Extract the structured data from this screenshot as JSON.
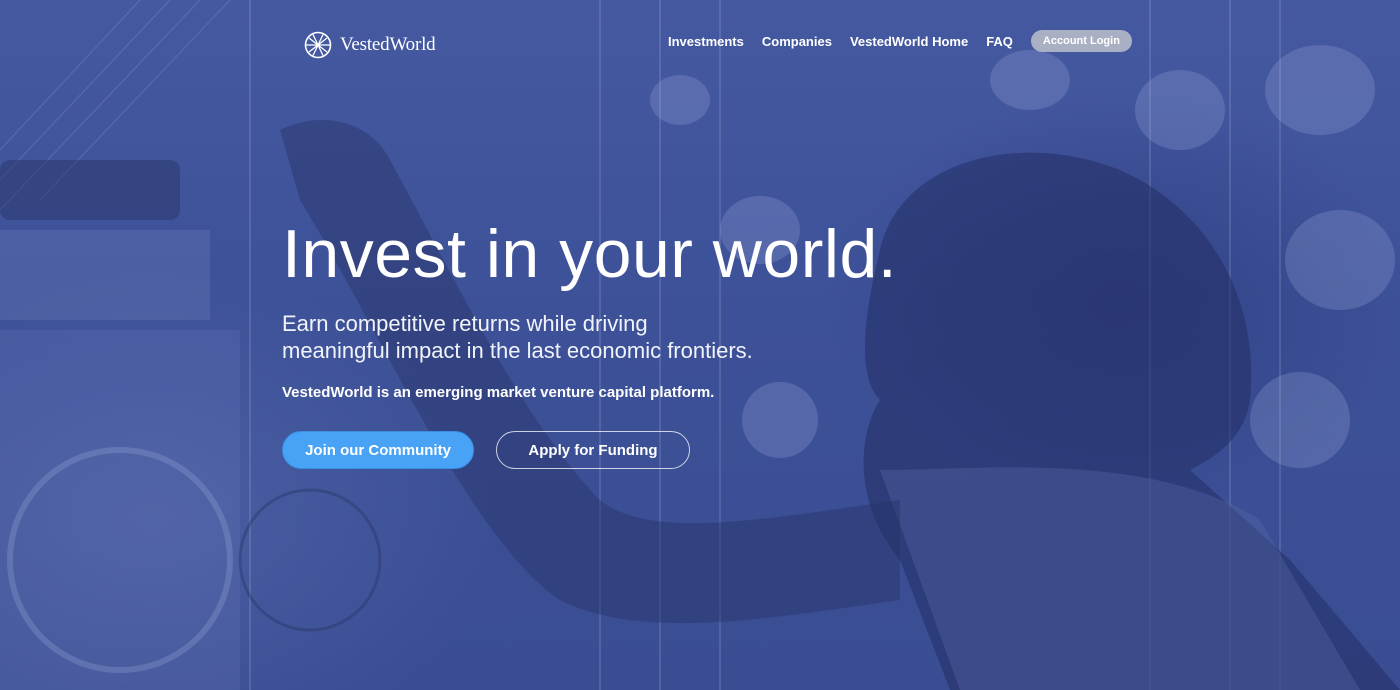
{
  "brand": {
    "name": "VestedWorld",
    "logo_icon": "globe-lattice-icon"
  },
  "nav": {
    "items": [
      {
        "label": "Investments"
      },
      {
        "label": "Companies"
      },
      {
        "label": "VestedWorld Home"
      },
      {
        "label": "FAQ"
      }
    ],
    "login_label": "Account Login"
  },
  "hero": {
    "headline": "Invest in your world.",
    "subhead_line1": "Earn competitive returns while driving",
    "subhead_line2": "meaningful impact in the last economic frontiers.",
    "tagline": "VestedWorld is an emerging market venture capital platform.",
    "primary_cta": "Join our Community",
    "secondary_cta": "Apply for Funding"
  },
  "colors": {
    "overlay": "#3d5198",
    "primary_button": "#48a2f5",
    "login_button": "#a9b0c4"
  }
}
